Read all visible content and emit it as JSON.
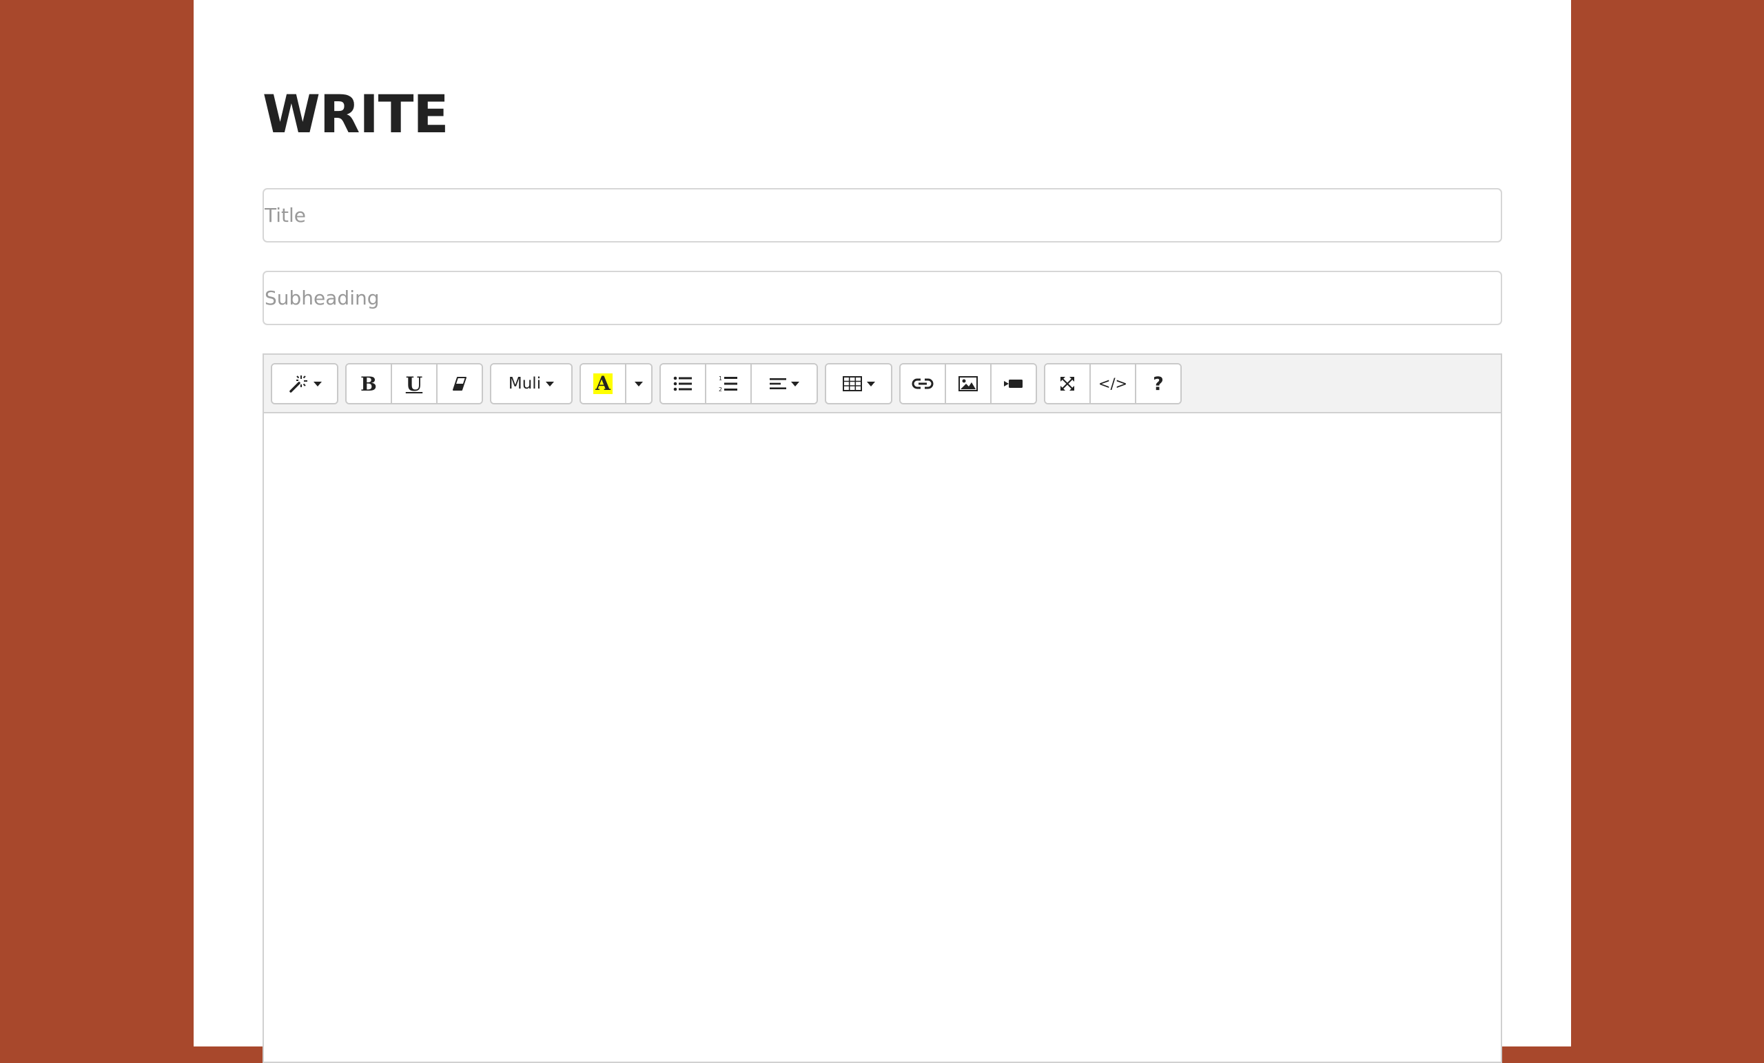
{
  "page": {
    "heading": "WRITE"
  },
  "form": {
    "title_placeholder": "Title",
    "subheading_placeholder": "Subheading"
  },
  "editor": {
    "toolbar": {
      "style_icon": "magic-wand-icon",
      "bold_label": "B",
      "underline_label": "U",
      "clear_format_icon": "eraser-icon",
      "font_family_value": "Muli",
      "highlight_label": "A",
      "highlight_color": "#FFFF00",
      "unordered_list_icon": "bullet-list-icon",
      "ordered_list_icon": "numbered-list-icon",
      "paragraph_align_icon": "align-left-icon",
      "table_icon": "table-icon",
      "link_icon": "link-icon",
      "picture_icon": "image-icon",
      "video_icon": "video-camera-icon",
      "fullscreen_icon": "fullscreen-icon",
      "codeview_label": "</>",
      "help_label": "?"
    },
    "content": ""
  },
  "colors": {
    "background": "#A8482C",
    "page": "#FFFFFF",
    "toolbar": "#F2F2F2",
    "highlight": "#FFFF00"
  }
}
